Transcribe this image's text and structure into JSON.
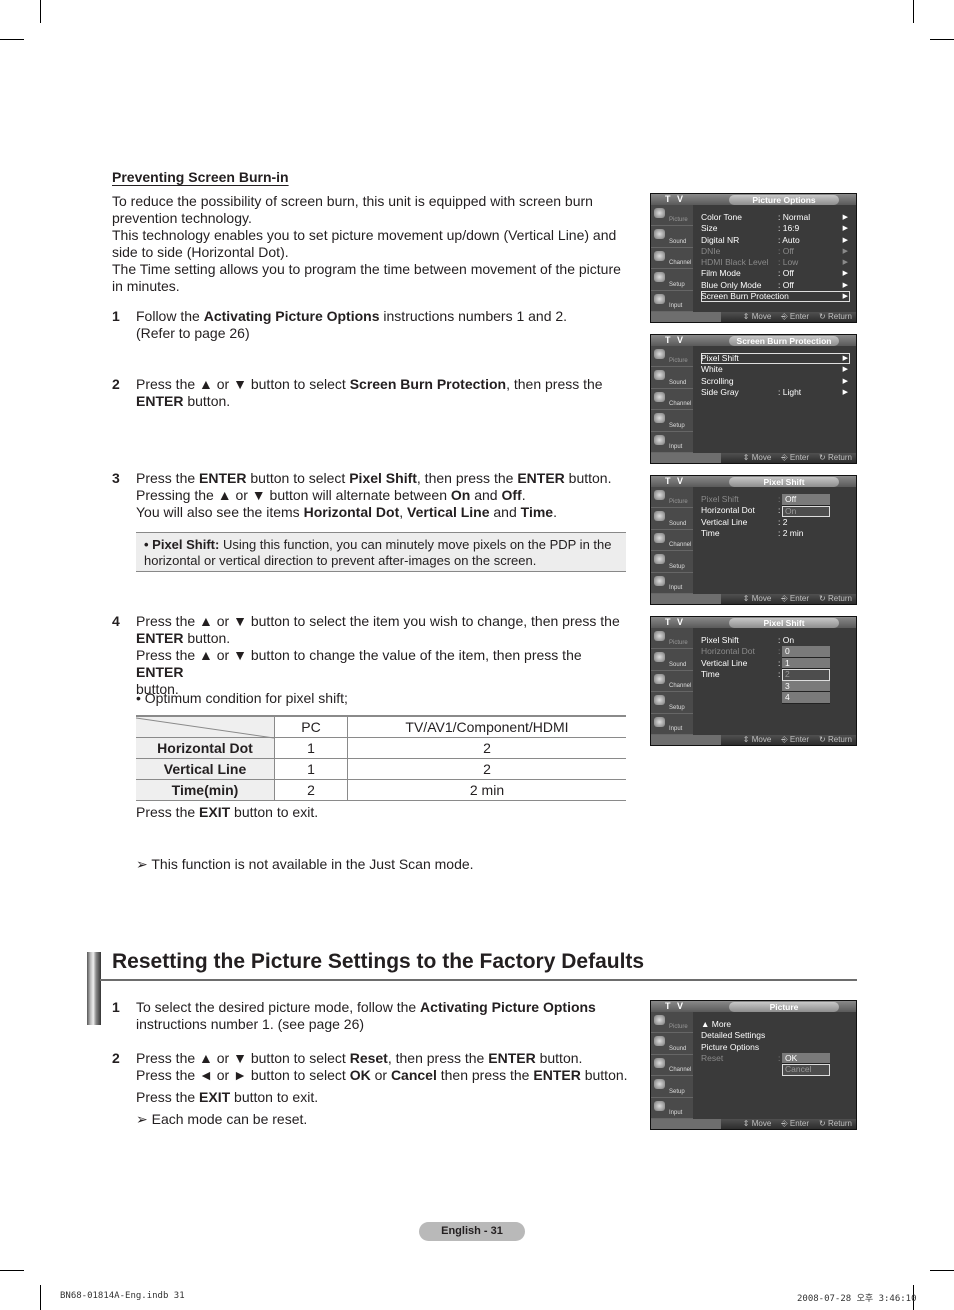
{
  "section1": {
    "title": "Preventing Screen Burn-in",
    "intro": [
      "To reduce the possibility of screen burn, this unit is equipped with screen burn prevention technology.",
      "This technology enables you to set picture movement up/down (Vertical Line) and side to side (Horizontal Dot).",
      "The Time setting allows you to program the time between movement of the picture in minutes."
    ],
    "steps": [
      {
        "num": "1",
        "parts": [
          [
            "Follow the ",
            ""
          ],
          [
            "Activating Picture Options",
            "b"
          ],
          [
            " instructions numbers 1 and 2.",
            ""
          ],
          [
            "\n(Refer to page 26)",
            ""
          ]
        ]
      },
      {
        "num": "2",
        "parts": [
          [
            "Press the ▲ or ▼ button to select ",
            ""
          ],
          [
            "Screen Burn Protection",
            "b"
          ],
          [
            ", then press the ",
            ""
          ],
          [
            "\nENTER",
            "b"
          ],
          [
            " button.",
            ""
          ]
        ]
      },
      {
        "num": "3",
        "parts": [
          [
            "Press the ",
            ""
          ],
          [
            "ENTER",
            "b"
          ],
          [
            " button to select ",
            ""
          ],
          [
            "Pixel Shift",
            "b"
          ],
          [
            ", then press the ",
            ""
          ],
          [
            "ENTER",
            "b"
          ],
          [
            " button.",
            ""
          ],
          [
            "\nPressing the ▲ or ▼ button will alternate between ",
            ""
          ],
          [
            "On",
            "b"
          ],
          [
            " and ",
            ""
          ],
          [
            "Off",
            "b"
          ],
          [
            ".",
            ""
          ],
          [
            "\nYou will also see the items ",
            ""
          ],
          [
            "Horizontal Dot",
            "b"
          ],
          [
            ", ",
            ""
          ],
          [
            "Vertical Line",
            "b"
          ],
          [
            " and ",
            ""
          ],
          [
            "Time",
            "b"
          ],
          [
            ".",
            ""
          ]
        ]
      },
      {
        "num": "4",
        "parts": [
          [
            "Press the ▲ or ▼ button to select the item you wish to change, then press the ",
            ""
          ],
          [
            "\nENTER",
            "b"
          ],
          [
            " button.",
            ""
          ],
          [
            "\nPress the ▲ or ▼ button to change the value of the item, then press the ",
            ""
          ],
          [
            "ENTER",
            "b"
          ],
          [
            "\nbutton.",
            ""
          ]
        ]
      }
    ],
    "note": {
      "label": "• Pixel Shift:",
      "text": " Using this function, you can minutely move pixels on the PDP in the horizontal or vertical direction to prevent after-images on the screen."
    },
    "optimum_label": "• Optimum condition for pixel shift;",
    "table": {
      "headers": [
        "",
        "PC",
        "TV/AV1/Component/HDMI"
      ],
      "rows": [
        [
          "Horizontal Dot",
          "1",
          "2"
        ],
        [
          "Vertical Line",
          "1",
          "2"
        ],
        [
          "Time(min)",
          "2",
          "2 min"
        ]
      ]
    },
    "exit_parts": [
      [
        "Press the ",
        ""
      ],
      [
        "EXIT",
        "b"
      ],
      [
        " button to exit.",
        ""
      ]
    ],
    "tip": "This function is not available in the Just Scan mode."
  },
  "section2": {
    "title": "Resetting the Picture Settings to the Factory Defaults",
    "steps": [
      {
        "num": "1",
        "parts": [
          [
            "To select the desired picture mode, follow the ",
            ""
          ],
          [
            "Activating Picture Options",
            "b"
          ],
          [
            "\ninstructions number 1. (see page 26)",
            ""
          ]
        ]
      },
      {
        "num": "2",
        "parts": [
          [
            "Press the ▲ or ▼ button to select ",
            ""
          ],
          [
            "Reset",
            "b"
          ],
          [
            ", then press the ",
            ""
          ],
          [
            "ENTER",
            "b"
          ],
          [
            " button.",
            ""
          ],
          [
            "\nPress the ◄ or ► button to select ",
            ""
          ],
          [
            "OK",
            "b"
          ],
          [
            " or ",
            ""
          ],
          [
            "Cancel",
            "b"
          ],
          [
            " then press the ",
            ""
          ],
          [
            "ENTER",
            "b"
          ],
          [
            " button.",
            ""
          ]
        ]
      }
    ],
    "exit_parts": [
      [
        "Press the ",
        ""
      ],
      [
        "EXIT",
        "b"
      ],
      [
        " button to exit.",
        ""
      ]
    ],
    "tip": "Each mode can be reset."
  },
  "tv_common": {
    "tv_label": "T V",
    "sidebar": [
      "Picture",
      "Sound",
      "Channel",
      "Setup",
      "Input"
    ],
    "hints": {
      "move": "Move",
      "enter": "Enter",
      "return": "Return"
    }
  },
  "tv_screens": [
    {
      "title": "Picture Options",
      "rows": [
        {
          "label": "Color Tone",
          "value": ": Normal",
          "arrow": true,
          "state": ""
        },
        {
          "label": "Size",
          "value": ": 16:9",
          "arrow": true,
          "state": ""
        },
        {
          "label": "Digital NR",
          "value": ": Auto",
          "arrow": true,
          "state": ""
        },
        {
          "label": "DNIe",
          "value": ": Off",
          "arrow": true,
          "state": "dim"
        },
        {
          "label": "HDMI Black Level",
          "value": ": Low",
          "arrow": true,
          "state": "dim"
        },
        {
          "label": "Film Mode",
          "value": ": Off",
          "arrow": true,
          "state": ""
        },
        {
          "label": "Blue Only Mode",
          "value": ": Off",
          "arrow": true,
          "state": ""
        },
        {
          "label": "Screen Burn Protection",
          "value": "",
          "arrow": true,
          "state": "sel"
        }
      ]
    },
    {
      "title": "Screen Burn Protection",
      "rows": [
        {
          "label": "Pixel Shift",
          "value": "",
          "arrow": true,
          "state": "sel"
        },
        {
          "label": "White",
          "value": "",
          "arrow": true,
          "state": ""
        },
        {
          "label": "Scrolling",
          "value": "",
          "arrow": true,
          "state": ""
        },
        {
          "label": "Side Gray",
          "value": ": Light",
          "arrow": true,
          "state": ""
        }
      ]
    },
    {
      "title": "Pixel Shift",
      "rows": [
        {
          "label": "Pixel Shift",
          "value": ":",
          "arrow": false,
          "state": "dim"
        },
        {
          "label": "Horizontal Dot",
          "value": ":",
          "arrow": false,
          "state": ""
        },
        {
          "label": "Vertical Line",
          "value": ": 2",
          "arrow": false,
          "state": ""
        },
        {
          "label": "Time",
          "value": ": 2 min",
          "arrow": false,
          "state": ""
        }
      ],
      "dropdown": {
        "row": 0,
        "options": [
          "Off",
          "On"
        ],
        "highlighted": 1
      }
    },
    {
      "title": "Pixel Shift",
      "rows": [
        {
          "label": "Pixel Shift",
          "value": ": On",
          "arrow": false,
          "state": ""
        },
        {
          "label": "Horizontal Dot",
          "value": ":",
          "arrow": false,
          "state": "dim"
        },
        {
          "label": "Vertical Line",
          "value": ":",
          "arrow": false,
          "state": ""
        },
        {
          "label": "Time",
          "value": ":",
          "arrow": false,
          "state": ""
        }
      ],
      "dropdown": {
        "row": 1,
        "options": [
          "0",
          "1",
          "2",
          "3",
          "4"
        ],
        "highlighted": 2
      }
    },
    {
      "title": "Picture",
      "rows": [
        {
          "label": "▲ More",
          "value": "",
          "arrow": false,
          "state": ""
        },
        {
          "label": "Detailed Settings",
          "value": "",
          "arrow": false,
          "state": ""
        },
        {
          "label": "Picture Options",
          "value": "",
          "arrow": false,
          "state": ""
        },
        {
          "label": "Reset",
          "value": ":",
          "arrow": false,
          "state": "dim"
        }
      ],
      "dropdown": {
        "row": 3,
        "options": [
          "OK",
          "Cancel"
        ],
        "highlighted": 1
      }
    }
  ],
  "footer": {
    "page_label": "English - 31",
    "slug_left": "BN68-01814A-Eng.indb   31",
    "slug_right": "2008-07-28   오후 3:46:10"
  }
}
